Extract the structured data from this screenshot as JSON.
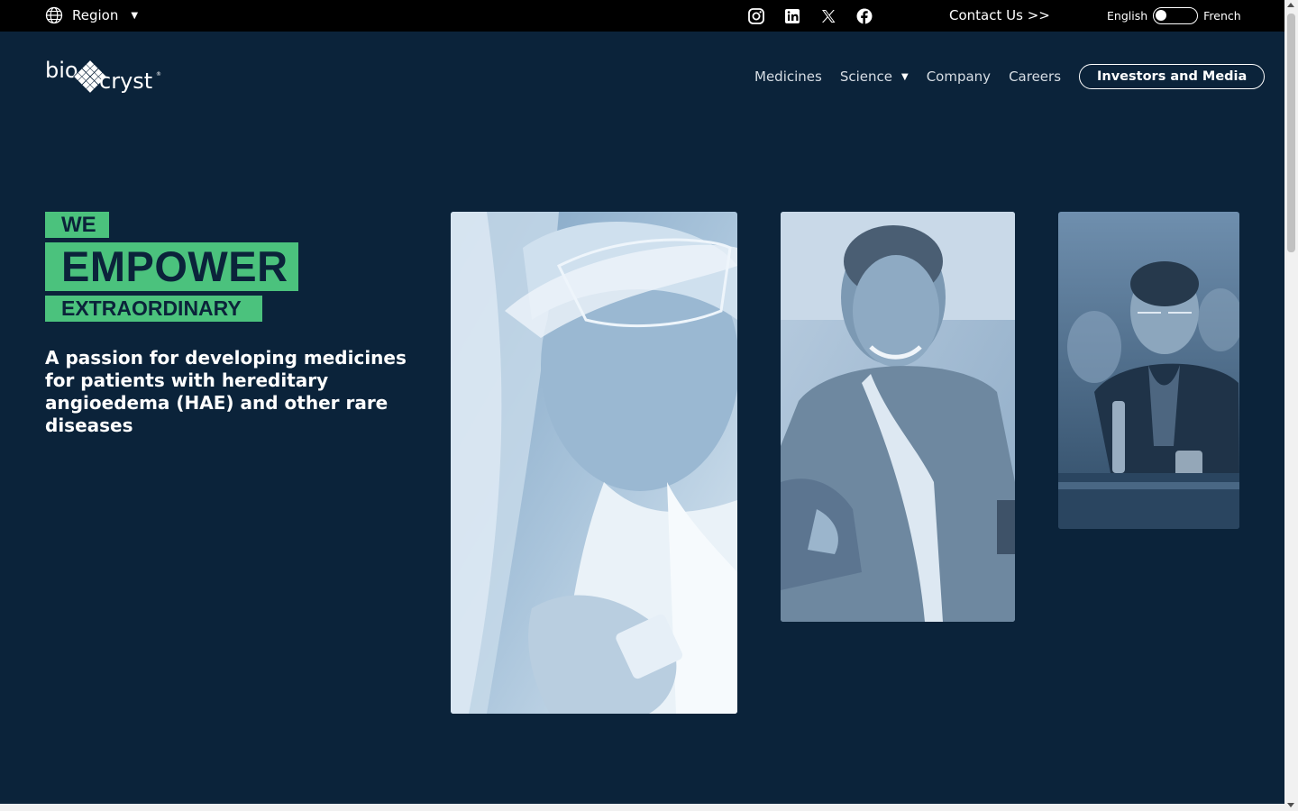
{
  "topbar": {
    "region_label": "Region",
    "region_icon": "globe-icon",
    "socials": [
      "instagram-icon",
      "linkedin-icon",
      "x-icon",
      "facebook-icon"
    ],
    "contact_label": "Contact Us >>",
    "lang_left": "English",
    "lang_right": "French"
  },
  "brand": {
    "logo_alt": "biocryst"
  },
  "nav": {
    "items": [
      "Medicines",
      "Science",
      "Company",
      "Careers"
    ],
    "cta_label": "Investors and Media"
  },
  "hero": {
    "line1": "WE",
    "line2": "EMPOWER",
    "line3": "EXTRAORDINARY",
    "lead": "A passion for developing medicines for patients with hereditary angioedema (HAE) and other rare diseases"
  },
  "colors": {
    "background": "#0b233a",
    "accent": "#4bc27d",
    "topbar": "#000000"
  }
}
